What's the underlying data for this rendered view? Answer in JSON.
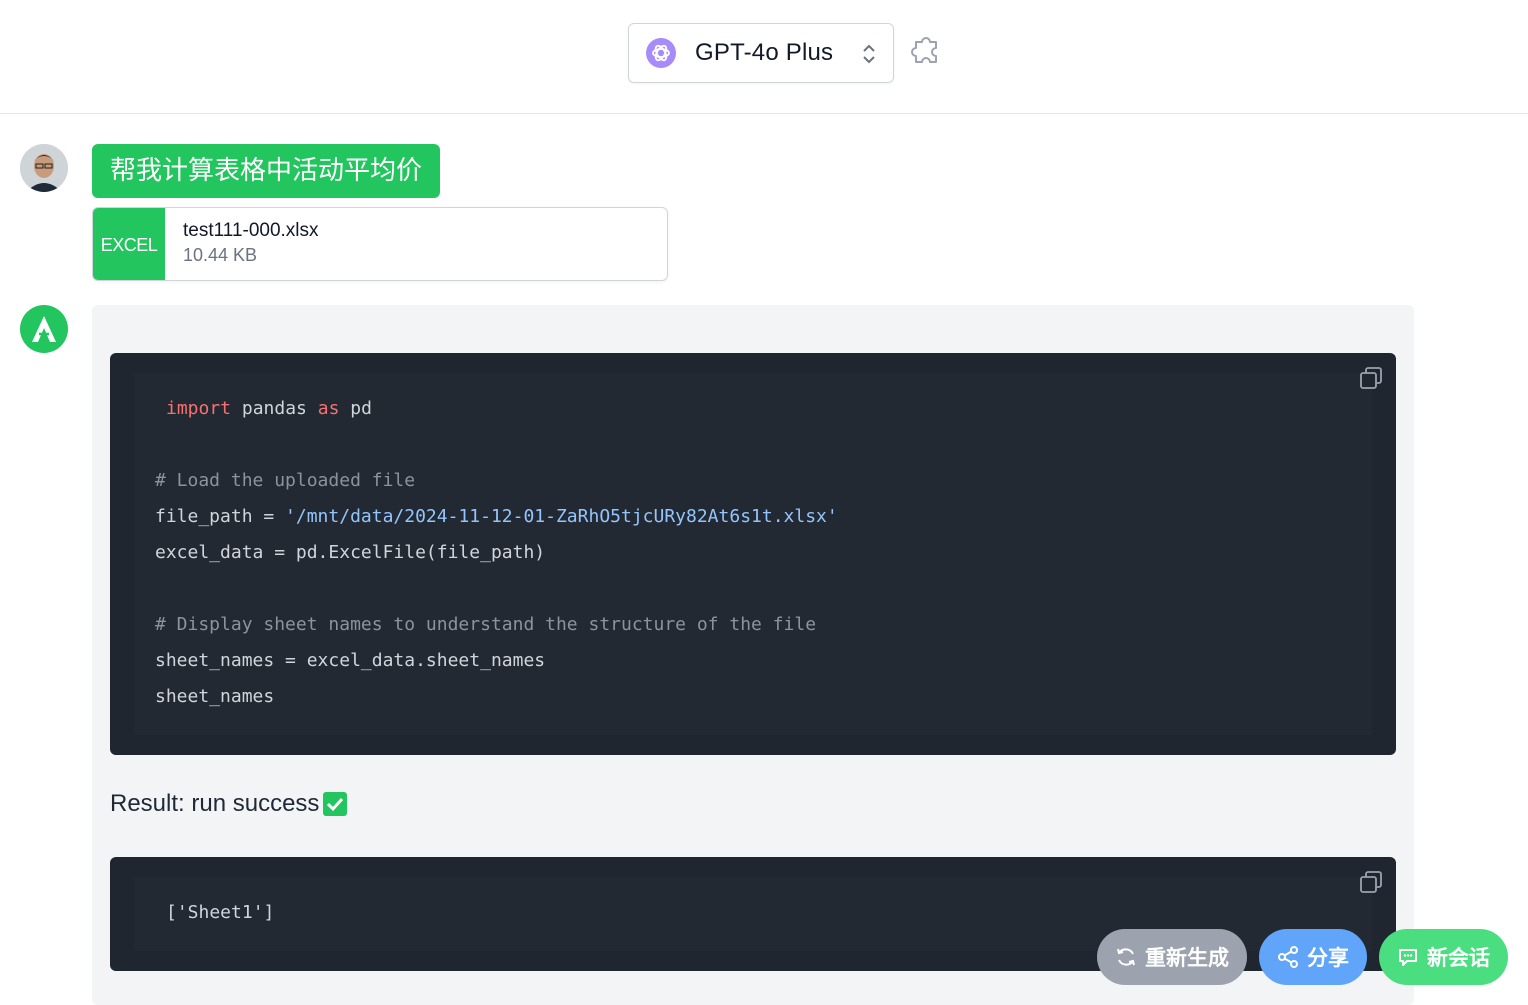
{
  "header": {
    "model_name": "GPT-4o Plus",
    "model_icon": "openai-logo-icon",
    "select_icon": "chevron-up-down-icon",
    "plugin_icon": "puzzle-piece-icon"
  },
  "conversation": {
    "user": {
      "avatar": "user-avatar-photo",
      "message": "帮我计算表格中活动平均价",
      "attachment": {
        "badge": "EXCEL",
        "file_name": "test111-000.xlsx",
        "file_size": "10.44 KB"
      }
    },
    "assistant": {
      "avatar": "bot-logo-icon",
      "code": {
        "line1_kw1": "import",
        "line1_mid": " pandas ",
        "line1_kw2": "as",
        "line1_end": " pd",
        "line2": "# Load the uploaded file",
        "line3_pre": "file_path = ",
        "line3_str": "'/mnt/data/2024-11-12-01-ZaRhO5tjcURy82At6s1t.xlsx'",
        "line4": "excel_data = pd.ExcelFile(file_path)",
        "line5": "# Display sheet names to understand the structure of the file",
        "line6": "sheet_names = excel_data.sheet_names",
        "line7": "sheet_names"
      },
      "result_label": "Result: run success",
      "output": "['Sheet1']"
    }
  },
  "actions": {
    "regenerate": "重新生成",
    "share": "分享",
    "new_chat": "新会话"
  },
  "colors": {
    "accent_green": "#22c55e",
    "code_bg": "#1f2630",
    "keyword": "#f87171",
    "string": "#93c5fd"
  }
}
